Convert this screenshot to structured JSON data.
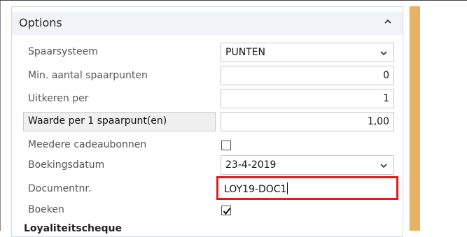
{
  "panel": {
    "title": "Options"
  },
  "fields": {
    "spaarsysteem": {
      "label": "Spaarsysteem",
      "value": "PUNTEN"
    },
    "min_spaarpunten": {
      "label": "Min. aantal spaarpunten",
      "value": "0"
    },
    "uitkeren_per": {
      "label": "Uitkeren per",
      "value": "1"
    },
    "waarde_per_punt": {
      "label": "Waarde per 1 spaarpunt(en)",
      "value": "1,00"
    },
    "meedere_cadeaubonnen": {
      "label": "Meedere cadeaubonnen",
      "checked": false
    },
    "boekingsdatum": {
      "label": "Boekingsdatum",
      "value": "23-4-2019"
    },
    "documentnr": {
      "label": "Documentnr.",
      "value": "LOY19-DOC1"
    },
    "boeken": {
      "label": "Boeken",
      "checked": true
    }
  },
  "section": {
    "next_label": "Loyaliteitscheque"
  },
  "colors": {
    "highlight_border": "#e01b1b",
    "side_strip": "#e8b264",
    "header_bg": "#f0f3f7"
  },
  "icons": {
    "collapse": "chevron-up-icon",
    "dropdown": "chevron-down-icon",
    "check": "checkmark-icon"
  }
}
